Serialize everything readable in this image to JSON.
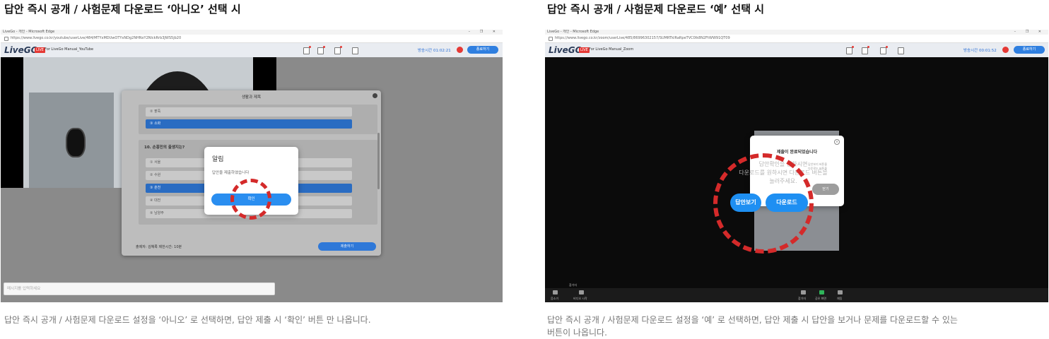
{
  "left": {
    "heading": "답안 즉시 공개 / 사험문제 다운로드 ‘아니오’ 선택 시",
    "description": "답안 즉시 공개 / 사험문제 다운로드 설정을 ‘아니오’ 로 선택하면, 답안 제출 시 ‘확인’ 버튼 만 나옵니다.",
    "screenshot": {
      "window_title": "LiveGo - 개인 - Microsoft Edge",
      "url": "https://www.livego.co.kr/youtube/userLive/484/MTYxMDUwOTYxNDg2NHNxY2NlckRrb3JWS5jb20",
      "logo": "LiveGO",
      "live_badge": "LIVE",
      "course_name": "For LiveGo Manual_YouTube",
      "timer": "방송시간 01:02:21",
      "end_button": "종료하기",
      "panel_title": "생활과 제목",
      "prev_options": [
        "② 팥죽",
        "③ 소화"
      ],
      "question": "10. 손흥민의 출생지는?",
      "options": [
        "① 서울",
        "② 수원",
        "③ 춘천",
        "④ 대전",
        "⑤ 남양주"
      ],
      "selected_option_index": 2,
      "footer_meta": "출제자:  김혜록      제한시간:  10분",
      "submit_button": "제출하기",
      "dialog": {
        "title": "알림",
        "message": "답안을 제출하였습니다",
        "confirm_button": "확인"
      },
      "chat_placeholder": "메시지를 입력하세요"
    }
  },
  "right": {
    "heading": "답안 즉시 공개 / 사험문제 다운로드 ‘예’ 선택 시",
    "description_line1": "답안 즉시 공개 / 사험문제 다운로드 설정을 ‘예’ 로 선택하면, 답안 제출 시 답안을 보거나 문제를 다운로드할 수 있는",
    "description_line2": "버튼이 나옵니다.",
    "screenshot": {
      "window_title": "LiveGo - 개인 - Microsoft Edge",
      "url": "https://www.livego.co.kr/zoom/userLive/485/86996302157/SUMRTkIRaRpeTVC0lk8N2FtWW91QT09",
      "logo": "LiveGO",
      "live_badge": "LIVE",
      "course_name": "For LiveGo Manual_Zoom",
      "timer": "방송시간 00:01:52",
      "end_button": "종료하기",
      "dialog": {
        "title": "제출이 완료되었습니다",
        "ghost_text_line1": "답안확인을 원하시면",
        "ghost_text_line2": "다운로드를 원하시면 다운로드 버튼을",
        "ghost_text_line3": "눌러주세요.",
        "small_text": "답안보기 버튼을\n다운로드 버튼을",
        "view_button": "답안보기",
        "download_button": "다운로드",
        "cancel_button": "닫기"
      },
      "zoom_labels": [
        "음소거",
        "비디오 시작",
        "참가자",
        "공유 화면",
        "채팅"
      ],
      "zoom_caption": "참가자"
    }
  },
  "colors": {
    "highlight_ring": "#d42a2a",
    "primary_button": "#1e8ff2",
    "live_badge": "#e53935"
  }
}
